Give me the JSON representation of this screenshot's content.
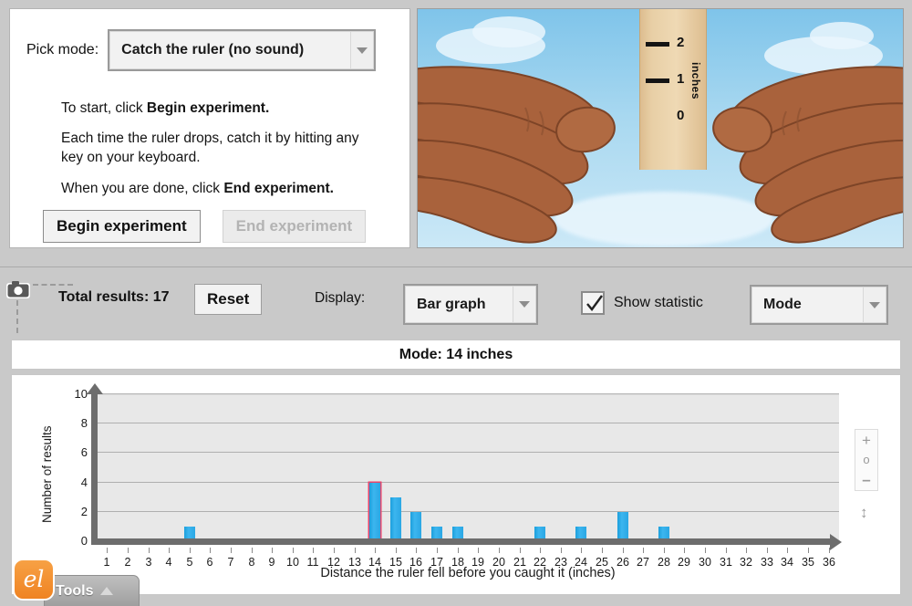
{
  "control_panel": {
    "pick_mode_label": "Pick mode:",
    "mode_value": "Catch the ruler (no sound)",
    "instructions": [
      "To start, click ",
      "Each time the ruler drops, catch it by hitting any key on your keyboard.",
      "When you are done, click "
    ],
    "instr1_prefix": "To start, click ",
    "instr1_bold": "Begin experiment.",
    "instr2": "Each time the ruler drops, catch it by hitting any key on your keyboard.",
    "instr3_prefix": "When you are done, click ",
    "instr3_bold": "End experiment.",
    "begin_button": "Begin experiment",
    "end_button": "End experiment"
  },
  "simulation": {
    "ruler_unit_label": "inches",
    "ruler_marks": [
      "2",
      "1",
      "0"
    ]
  },
  "toolbar": {
    "camera_icon": "camera-icon",
    "total_results_label": "Total results: 17",
    "reset_button": "Reset",
    "display_label": "Display:",
    "display_value": "Bar graph",
    "show_statistic_label": "Show statistic",
    "show_statistic_checked": true,
    "statistic_value": "Mode"
  },
  "stat_header": {
    "text": "Mode: 14 inches"
  },
  "zoom_controls": {
    "zoom_in": "+",
    "zoom_reset": "o",
    "zoom_out": "–",
    "vertical_scale": "↕"
  },
  "tools": {
    "label": "Tools",
    "logo_text": "el"
  },
  "colors": {
    "bar": "#2aa7e4",
    "mode_outline": "#e8446b",
    "plot_background": "#e8e8e8",
    "axis": "#6d6d6d",
    "app_background": "#c9c9c9",
    "brand_orange": "#ef8322"
  },
  "chart_data": {
    "type": "bar",
    "title": "Mode: 14 inches",
    "xlabel": "Distance the ruler fell before you caught it (inches)",
    "ylabel": "Number of results",
    "ylim": [
      0,
      10
    ],
    "ytick_values": [
      0,
      2,
      4,
      6,
      8,
      10
    ],
    "grid": true,
    "legend": "none",
    "highlight_category": 14,
    "highlight_reason": "mode",
    "total_results": 17,
    "categories": [
      1,
      2,
      3,
      4,
      5,
      6,
      7,
      8,
      9,
      10,
      11,
      12,
      13,
      14,
      15,
      16,
      17,
      18,
      19,
      20,
      21,
      22,
      23,
      24,
      25,
      26,
      27,
      28,
      29,
      30,
      31,
      32,
      33,
      34,
      35,
      36
    ],
    "values": [
      0,
      0,
      0,
      0,
      1,
      0,
      0,
      0,
      0,
      0,
      0,
      0,
      0,
      4,
      3,
      2,
      1,
      1,
      0,
      0,
      0,
      1,
      0,
      1,
      0,
      2,
      0,
      1,
      0,
      0,
      0,
      0,
      0,
      0,
      0,
      0
    ]
  }
}
